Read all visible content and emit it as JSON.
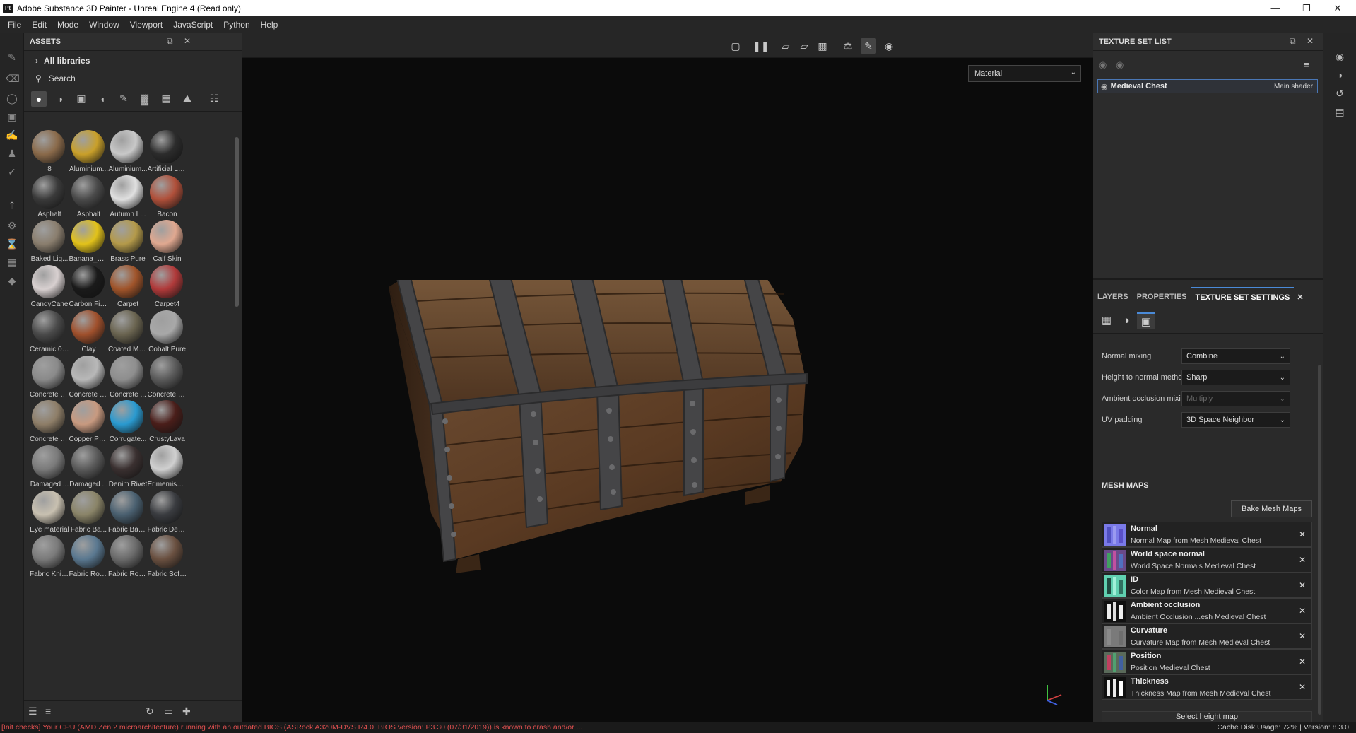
{
  "window": {
    "title": "Adobe Substance 3D Painter - Unreal Engine 4 (Read only)",
    "app_badge": "Pt"
  },
  "menu": [
    "File",
    "Edit",
    "Mode",
    "Window",
    "Viewport",
    "JavaScript",
    "Python",
    "Help"
  ],
  "assets": {
    "title": "ASSETS",
    "library": "All libraries",
    "search_placeholder": "Search",
    "items": [
      {
        "label": "8",
        "color": "#8a6a4a"
      },
      {
        "label": "Aluminium...",
        "color": "#c9a02a"
      },
      {
        "label": "Aluminium...",
        "color": "#c8c8c8"
      },
      {
        "label": "Artificial Le...",
        "color": "#2c2c2c"
      },
      {
        "label": "Asphalt",
        "color": "#3a3a3a"
      },
      {
        "label": "Asphalt",
        "color": "#4a4a4a"
      },
      {
        "label": "Autumn L...",
        "color": "#e0e0e0"
      },
      {
        "label": "Bacon",
        "color": "#b0503a"
      },
      {
        "label": "Baked Lig...",
        "color": "#8a7e6e"
      },
      {
        "label": "Banana_Sk...",
        "color": "#e2c21a"
      },
      {
        "label": "Brass Pure",
        "color": "#b49a4a"
      },
      {
        "label": "Calf Skin",
        "color": "#e0a890"
      },
      {
        "label": "CandyCane",
        "color": "#d8d0d0"
      },
      {
        "label": "Carbon Fiber",
        "color": "#1a1a1a"
      },
      {
        "label": "Carpet",
        "color": "#a0542a"
      },
      {
        "label": "Carpet4",
        "color": "#b03a3a"
      },
      {
        "label": "Ceramic 004",
        "color": "#4a4a4a"
      },
      {
        "label": "Clay",
        "color": "#a0502c"
      },
      {
        "label": "Coated Me...",
        "color": "#6a6450"
      },
      {
        "label": "Cobalt Pure",
        "color": "#a8a8a8"
      },
      {
        "label": "Concrete B...",
        "color": "#8a8a8a"
      },
      {
        "label": "Concrete C...",
        "color": "#b8b8b8"
      },
      {
        "label": "Concrete ...",
        "color": "#8e8e8e"
      },
      {
        "label": "Concrete S...",
        "color": "#5a5a5a"
      },
      {
        "label": "Concrete S...",
        "color": "#8e7e68"
      },
      {
        "label": "Copper Pure",
        "color": "#c89a80"
      },
      {
        "label": "Corrugate...",
        "color": "#2a9ad0"
      },
      {
        "label": "CrustyLava",
        "color": "#4a1e1a"
      },
      {
        "label": "Damaged ...",
        "color": "#7a7a7a"
      },
      {
        "label": "Damaged ...",
        "color": "#5a5a5a"
      },
      {
        "label": "Denim Rivet",
        "color": "#3a3030"
      },
      {
        "label": "ErimemisKar",
        "color": "#d0d0d0"
      },
      {
        "label": "Eye material",
        "color": "#c8c0b0"
      },
      {
        "label": "Fabric Ba...",
        "color": "#8a8468"
      },
      {
        "label": "Fabric Bas...",
        "color": "#4a6070"
      },
      {
        "label": "Fabric Den...",
        "color": "#3a3c40"
      },
      {
        "label": "Fabric Knit...",
        "color": "#7a7a7a"
      },
      {
        "label": "Fabric Rou...",
        "color": "#5a7890"
      },
      {
        "label": "Fabric Rou...",
        "color": "#6a6a6a"
      },
      {
        "label": "Fabric Soft...",
        "color": "#6a5040"
      }
    ]
  },
  "viewport": {
    "mode": "Material"
  },
  "texture_set_list": {
    "title": "TEXTURE SET LIST",
    "set_name": "Medieval Chest",
    "shader": "Main shader"
  },
  "tabs": {
    "layers": "LAYERS",
    "properties": "PROPERTIES",
    "tss": "TEXTURE SET SETTINGS"
  },
  "settings": {
    "normal_mixing": {
      "label": "Normal mixing",
      "value": "Combine"
    },
    "height_to_normal": {
      "label": "Height to normal method",
      "value": "Sharp"
    },
    "ao_mixing": {
      "label": "Ambient occlusion mixing",
      "value": "Multiply"
    },
    "uv_padding": {
      "label": "UV padding",
      "value": "3D Space Neighbor"
    }
  },
  "mesh_maps": {
    "title": "MESH MAPS",
    "bake_label": "Bake Mesh Maps",
    "items": [
      {
        "name": "Normal",
        "desc": "Normal Map from Mesh Medieval Chest"
      },
      {
        "name": "World space normal",
        "desc": "World Space Normals Medieval Chest"
      },
      {
        "name": "ID",
        "desc": "Color Map from Mesh Medieval Chest"
      },
      {
        "name": "Ambient occlusion",
        "desc": "Ambient Occlusion ...esh Medieval Chest"
      },
      {
        "name": "Curvature",
        "desc": "Curvature Map from Mesh Medieval Chest"
      },
      {
        "name": "Position",
        "desc": "Position Medieval Chest"
      },
      {
        "name": "Thickness",
        "desc": "Thickness Map from Mesh Medieval Chest"
      }
    ],
    "select_height": "Select height map"
  },
  "status": {
    "error": "[Init checks] Your CPU (AMD Zen 2 microarchitecture) running with an outdated BIOS (ASRock A320M-DVS R4.0, BIOS version: P3.30 (07/31/2019)) is known to crash and/or ...",
    "cache": "Cache Disk Usage:   72% | Version: 8.3.0"
  }
}
